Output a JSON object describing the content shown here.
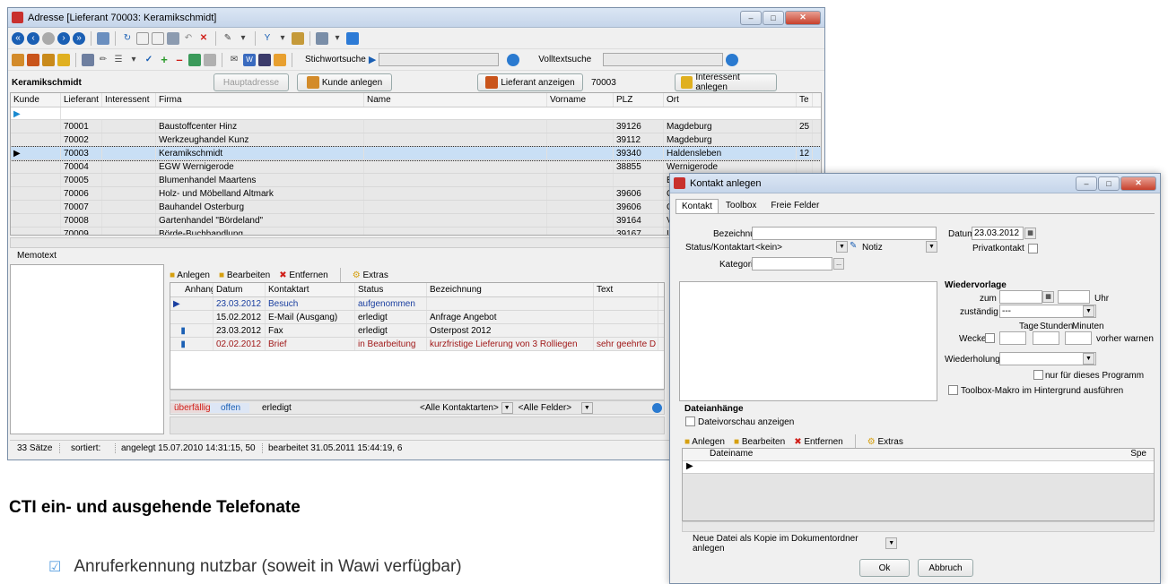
{
  "main": {
    "title": "Adresse [Lieferant 70003: Keramikschmidt]",
    "stichwort_label": "Stichwortsuche",
    "volltext_label": "Volltextsuche",
    "record_name": "Keramikschmidt",
    "hauptadresse": "Hauptadresse",
    "kunde_anlegen": "Kunde anlegen",
    "lieferant_anzeigen": "Lieferant anzeigen",
    "lieferant_nr": "70003",
    "interessent_anlegen": "Interessent anlegen",
    "columns": [
      "Kunde",
      "Lieferant",
      "Interessent",
      "Firma",
      "Name",
      "Vorname",
      "PLZ",
      "Ort",
      "Te"
    ],
    "rows": [
      {
        "lief": "70001",
        "firma": "Baustoffcenter Hinz",
        "plz": "39126",
        "ort": "Magdeburg",
        "te": "25"
      },
      {
        "lief": "70002",
        "firma": "Werkzeughandel Kunz",
        "plz": "39112",
        "ort": "Magdeburg",
        "te": ""
      },
      {
        "lief": "70003",
        "firma": "Keramikschmidt",
        "plz": "39340",
        "ort": "Haldensleben",
        "te": "12"
      },
      {
        "lief": "70004",
        "firma": "EGW Wernigerode",
        "plz": "38855",
        "ort": "Wernigerode",
        "te": ""
      },
      {
        "lief": "70005",
        "firma": "Blumenhandel Maartens",
        "plz": "",
        "ort": "Eindhoven",
        "te": ""
      },
      {
        "lief": "70006",
        "firma": "Holz- und Möbelland Altmark",
        "plz": "39606",
        "ort": "C",
        "te": ""
      },
      {
        "lief": "70007",
        "firma": "Bauhandel Osterburg",
        "plz": "39606",
        "ort": "C",
        "te": ""
      },
      {
        "lief": "70008",
        "firma": "Gartenhandel \"Bördeland\"",
        "plz": "39164",
        "ort": "V",
        "te": ""
      },
      {
        "lief": "70009",
        "firma": "Börde-Buchhandlung",
        "plz": "39167",
        "ort": "I",
        "te": ""
      }
    ],
    "memotext": "Memotext",
    "contact_toolbar": [
      "Anlegen",
      "Bearbeiten",
      "Entfernen",
      "Extras"
    ],
    "contact_columns": [
      "Anhang",
      "Datum",
      "Kontaktart",
      "Status",
      "Bezeichnung",
      "Text"
    ],
    "contacts": [
      {
        "datum": "23.03.2012",
        "art": "Besuch",
        "status": "aufgenommen",
        "bez": "",
        "text": ""
      },
      {
        "datum": "15.02.2012",
        "art": "E-Mail (Ausgang)",
        "status": "erledigt",
        "bez": "Anfrage Angebot",
        "text": ""
      },
      {
        "datum": "23.03.2012",
        "art": "Fax",
        "status": "erledigt",
        "bez": "Osterpost 2012",
        "text": ""
      },
      {
        "datum": "02.02.2012",
        "art": "Brief",
        "status": "in Bearbeitung",
        "bez": "kurzfristige Lieferung von 3 Rolliegen",
        "text": "sehr geehrte D"
      }
    ],
    "filter_tabs": [
      "überfällig",
      "offen",
      "erledigt"
    ],
    "filter_kontaktarten": "<Alle Kontaktarten>",
    "filter_felder": "<Alle Felder>",
    "status_saetze": "33 Sätze",
    "status_sortiert": "sortiert:",
    "status_angelegt": "angelegt 15.07.2010 14:31:15, 50",
    "status_bearbeitet": "bearbeitet 31.05.2011 15:44:19, 6"
  },
  "dialog": {
    "title": "Kontakt anlegen",
    "tabs": [
      "Kontakt",
      "Toolbox",
      "Freie Felder"
    ],
    "bezeichnung": "Bezeichnung",
    "status_kontaktart": "Status/Kontaktart",
    "status_value": "<kein>",
    "kontaktart_value": "Notiz",
    "kategorie": "Kategorie",
    "datum_label": "Datum",
    "datum_value": "23.03.2012",
    "privatkontakt": "Privatkontakt",
    "wiedervorlage": "Wiedervorlage",
    "zum": "zum",
    "uhr": "Uhr",
    "zustaendig": "zuständig",
    "zustaendig_value": "---",
    "tage": "Tage",
    "stunden": "Stunden",
    "minuten": "Minuten",
    "wecker": "Wecker",
    "vorher_warnen": "vorher warnen",
    "wiederholung": "Wiederholung",
    "nur_programm": "nur für dieses Programm",
    "toolbox_makro": "Toolbox-Makro im Hintergrund ausführen",
    "dateianhaenge": "Dateianhänge",
    "dateivorschau": "Dateivorschau anzeigen",
    "file_toolbar": [
      "Anlegen",
      "Bearbeiten",
      "Entfernen",
      "Extras"
    ],
    "dateiname": "Dateiname",
    "spe": "Spe",
    "copy_option": "Neue Datei als Kopie im Dokumentordner anlegen",
    "ok": "Ok",
    "abbruch": "Abbruch"
  },
  "caption": {
    "heading": "CTI ein- und ausgehende Telefonate",
    "bullet": "Anruferkennung nutzbar (soweit in Wawi verfügbar)"
  }
}
